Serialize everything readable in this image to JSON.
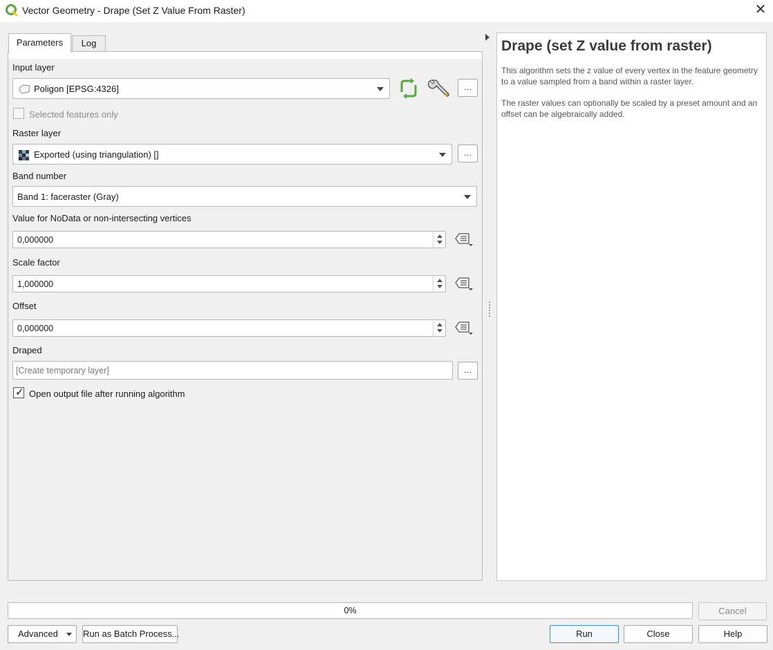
{
  "window": {
    "title": "Vector Geometry - Drape (Set Z Value From Raster)",
    "close_glyph": "✕",
    "app_icon": "qgis-logo-icon"
  },
  "tabs": [
    {
      "label": "Parameters",
      "active": true
    },
    {
      "label": "Log",
      "active": false
    }
  ],
  "params": {
    "input_layer": {
      "label": "Input layer",
      "value": "Poligon [EPSG:4326]",
      "icon": "polygon-layer-icon"
    },
    "selected_only": {
      "label": "Selected features only",
      "checked": false,
      "enabled": false
    },
    "raster_layer": {
      "label": "Raster layer",
      "value": "Exported (using triangulation) []",
      "icon": "raster-layer-icon"
    },
    "band": {
      "label": "Band number",
      "value": "Band 1: faceraster (Gray)"
    },
    "nodata": {
      "label": "Value for NoData or non-intersecting vertices",
      "value": "0,000000"
    },
    "scale": {
      "label": "Scale factor",
      "value": "1,000000"
    },
    "offset": {
      "label": "Offset",
      "value": "0,000000"
    },
    "draped": {
      "label": "Draped",
      "placeholder": "[Create temporary layer]"
    },
    "open_output": {
      "label": "Open output file after running algorithm",
      "checked": true
    },
    "ellipsis": "…"
  },
  "help": {
    "title": "Drape (set Z value from raster)",
    "paragraphs": [
      "This algorithm sets the z value of every vertex in the feature geometry to a value sampled from a band within a raster layer.",
      "The raster values can optionally be scaled by a preset amount and an offset can be algebraically added."
    ]
  },
  "progress": {
    "value": 0,
    "text": "0%"
  },
  "buttons": {
    "cancel": "Cancel",
    "advanced": "Advanced",
    "batch": "Run as Batch Process...",
    "run": "Run",
    "close": "Close",
    "help": "Help"
  },
  "colors": {
    "accent": "#3b8ed8",
    "progress_fill": "#3daee9",
    "qgis_green": "#58a83e",
    "qgis_yellow": "#f0c93a"
  }
}
